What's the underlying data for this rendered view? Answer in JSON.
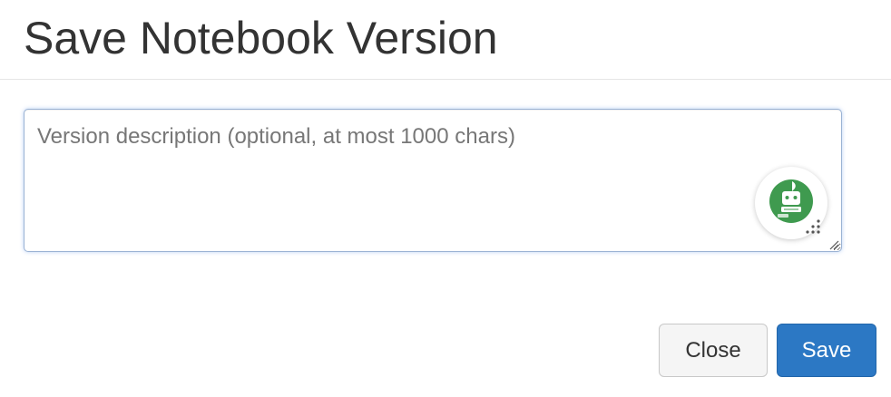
{
  "dialog": {
    "title": "Save Notebook Version"
  },
  "description": {
    "value": "",
    "placeholder": "Version description (optional, at most 1000 chars)"
  },
  "assistant": {
    "icon": "robot-assistant-icon",
    "color": "#3f9a4f"
  },
  "buttons": {
    "close_label": "Close",
    "save_label": "Save"
  },
  "colors": {
    "primary": "#2c78c4",
    "focus_border": "#9bb3d4"
  }
}
